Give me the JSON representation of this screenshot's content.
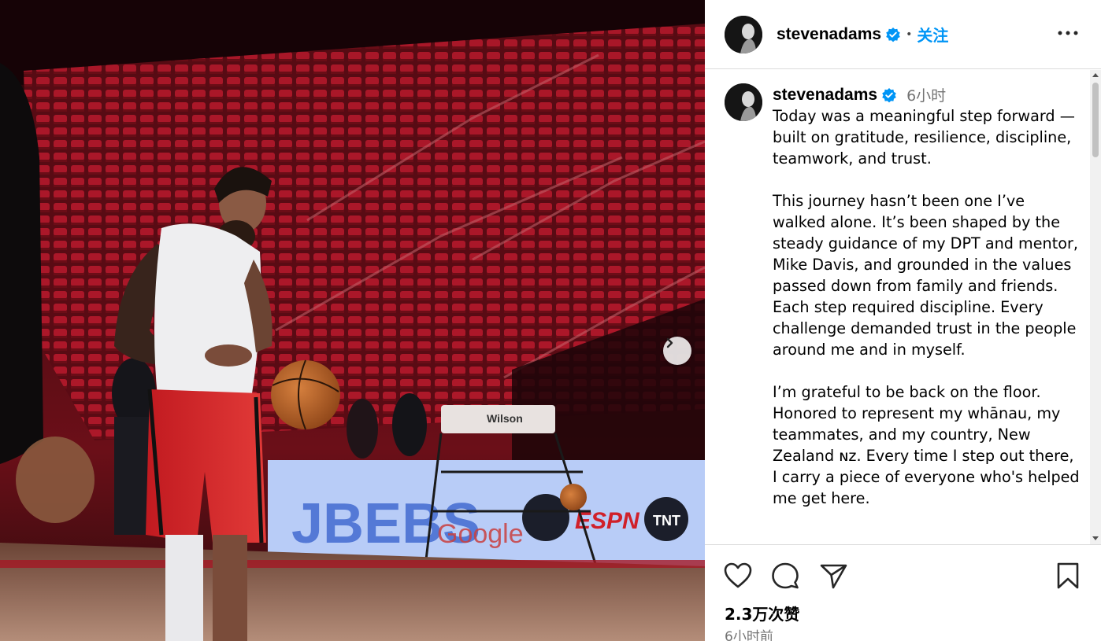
{
  "post": {
    "username": "stevenadams",
    "follow_label": "关注",
    "separator": "•",
    "caption_username": "stevenadams",
    "caption_time": "6小时",
    "caption": "Today was a meaningful step forward —built on gratitude, resilience, discipline, teamwork, and trust.\n\nThis journey hasn’t been one I’ve walked alone. It’s been shaped by the steady guidance of my DPT and mentor, Mike Davis, and grounded in the values passed down from family and friends. Each step required discipline. Every challenge demanded trust in the people around me and in myself.\n\nI’m grateful to be back on the floor. Honored to represent my whānau, my teammates, and my country, New Zealand ɴᴢ. Every time I step out there, I carry a piece of everyone who's helped me get here.",
    "likes": "2.3万次赞",
    "posted_ago": "6小时前"
  },
  "photo": {
    "court_signage": [
      "Wilson",
      "ESPN",
      "TNT",
      "Google"
    ]
  },
  "icons": {
    "verified": "verified-badge-icon",
    "more": "more-options-icon",
    "next": "chevron-right-icon",
    "like": "heart-icon",
    "comment": "comment-icon",
    "share": "share-icon",
    "save": "bookmark-icon"
  },
  "colors": {
    "accent": "#0095f6",
    "muted": "#737373",
    "border": "#dbdbdb"
  }
}
